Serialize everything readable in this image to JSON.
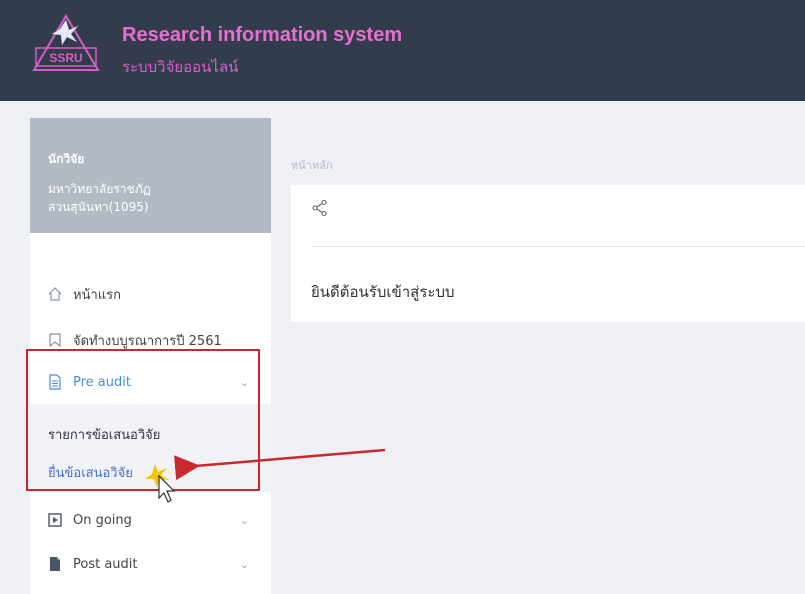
{
  "header": {
    "title": "Research information system",
    "subtitle": "ระบบวิจัยออนไลน์",
    "logo_text": "SSRU"
  },
  "user": {
    "role": "นักวิจัย",
    "org_line1": "มหาวิทยาลัยราชภัฏ",
    "org_line2": "สวนสุนันทา(1095)"
  },
  "sidebar": {
    "items": [
      {
        "label": "หน้าแรก",
        "icon": "home-icon"
      },
      {
        "label": "จัดทำงบบูรณาการปี 2561",
        "icon": "bookmark-icon"
      },
      {
        "label": "Pre audit",
        "icon": "document-icon",
        "expanded": true
      },
      {
        "label": "On going",
        "icon": "play-icon"
      },
      {
        "label": "Post audit",
        "icon": "file-icon"
      }
    ],
    "pre_audit_sub": [
      {
        "label": "รายการข้อเสนอวิจัย"
      },
      {
        "label": "ยื่นข้อเสนอวิจัย"
      }
    ]
  },
  "main": {
    "breadcrumb": "หน้าหลัก",
    "welcome": "ยินดีต้อนรับเข้าสู่ระบบ"
  },
  "colors": {
    "header_bg": "#323c4c",
    "title": "#e86ed0",
    "accent": "#4a8fd6",
    "annotation": "#c9282e"
  }
}
